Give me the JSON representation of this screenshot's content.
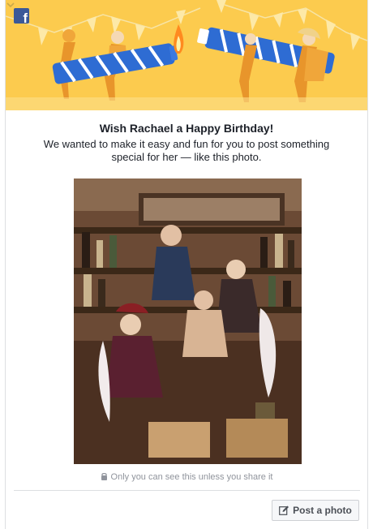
{
  "header": {
    "logo_letter": "f",
    "logo_color": "#3b5998",
    "banner_color": "#fccb4e",
    "menu_icon": "chevron-down-icon"
  },
  "main": {
    "title": "Wish Rachael a Happy Birthday!",
    "subtitle": "We wanted to make it easy and fun for you to post something special for her — like this photo.",
    "photo_icon": "photo",
    "privacy_text": "Only you can see this unless you share it",
    "privacy_icon": "lock-icon"
  },
  "footer": {
    "post_button_label": "Post a photo",
    "post_button_icon": "edit-icon"
  }
}
